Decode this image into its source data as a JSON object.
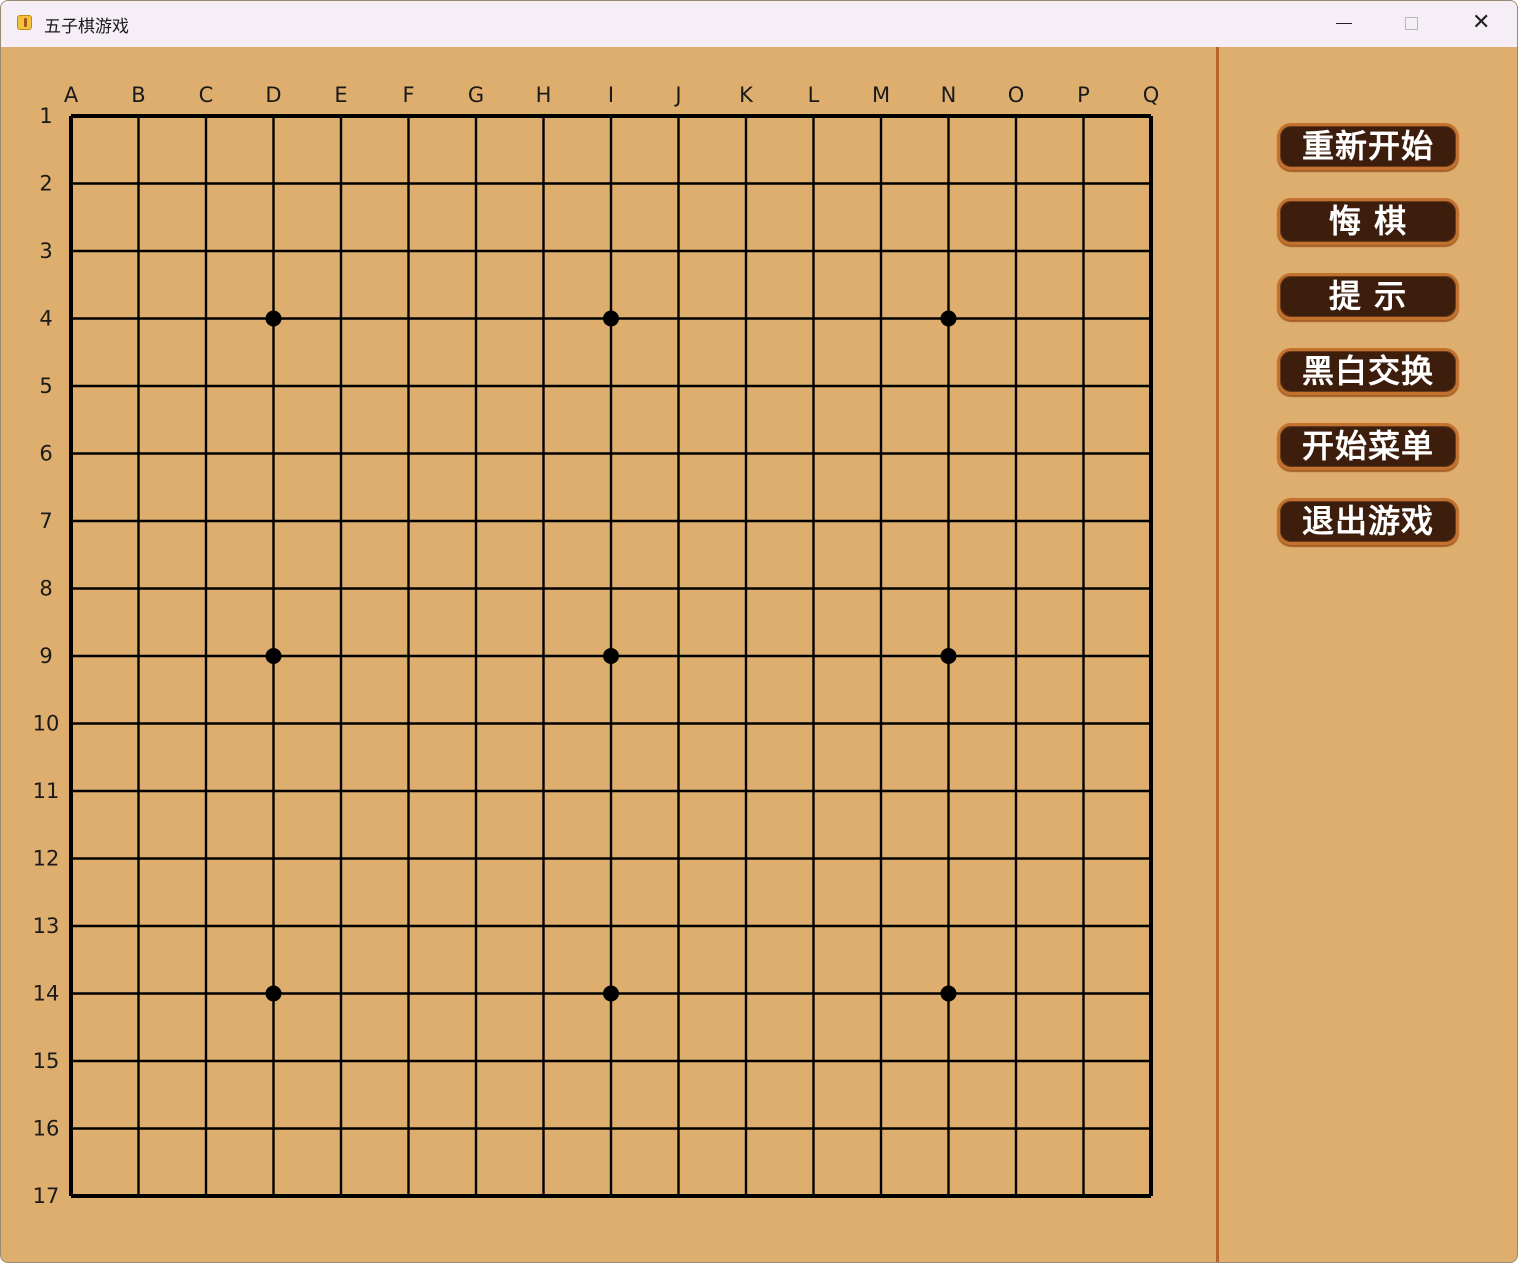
{
  "window": {
    "title": "五子棋游戏",
    "icons": {
      "app": "gomoku-app-icon",
      "minimize": "minimize-icon",
      "maximize": "maximize-icon",
      "close": "close-icon"
    },
    "close_glyph": "✕"
  },
  "board": {
    "size": 17,
    "columns": [
      "A",
      "B",
      "C",
      "D",
      "E",
      "F",
      "G",
      "H",
      "I",
      "J",
      "K",
      "L",
      "M",
      "N",
      "O",
      "P",
      "Q"
    ],
    "rows": [
      "1",
      "2",
      "3",
      "4",
      "5",
      "6",
      "7",
      "8",
      "9",
      "10",
      "11",
      "12",
      "13",
      "14",
      "15",
      "16",
      "17"
    ],
    "star_points": [
      {
        "col": "D",
        "row": 4
      },
      {
        "col": "I",
        "row": 4
      },
      {
        "col": "N",
        "row": 4
      },
      {
        "col": "D",
        "row": 9
      },
      {
        "col": "I",
        "row": 9
      },
      {
        "col": "N",
        "row": 9
      },
      {
        "col": "D",
        "row": 14
      },
      {
        "col": "I",
        "row": 14
      },
      {
        "col": "N",
        "row": 14
      }
    ],
    "stones": [],
    "colors": {
      "background": "#deae6e",
      "lines": "#000000",
      "divider": "#b6642a"
    }
  },
  "menu": {
    "buttons": [
      {
        "id": "restart",
        "label": "重新开始"
      },
      {
        "id": "undo",
        "label": "悔 棋"
      },
      {
        "id": "hint",
        "label": "提 示"
      },
      {
        "id": "swap",
        "label": "黑白交换"
      },
      {
        "id": "start-menu",
        "label": "开始菜单"
      },
      {
        "id": "exit",
        "label": "退出游戏"
      }
    ],
    "colors": {
      "button_bg": "#3d1d0c",
      "button_border": "#c2722c",
      "button_text": "#ffffff"
    }
  }
}
